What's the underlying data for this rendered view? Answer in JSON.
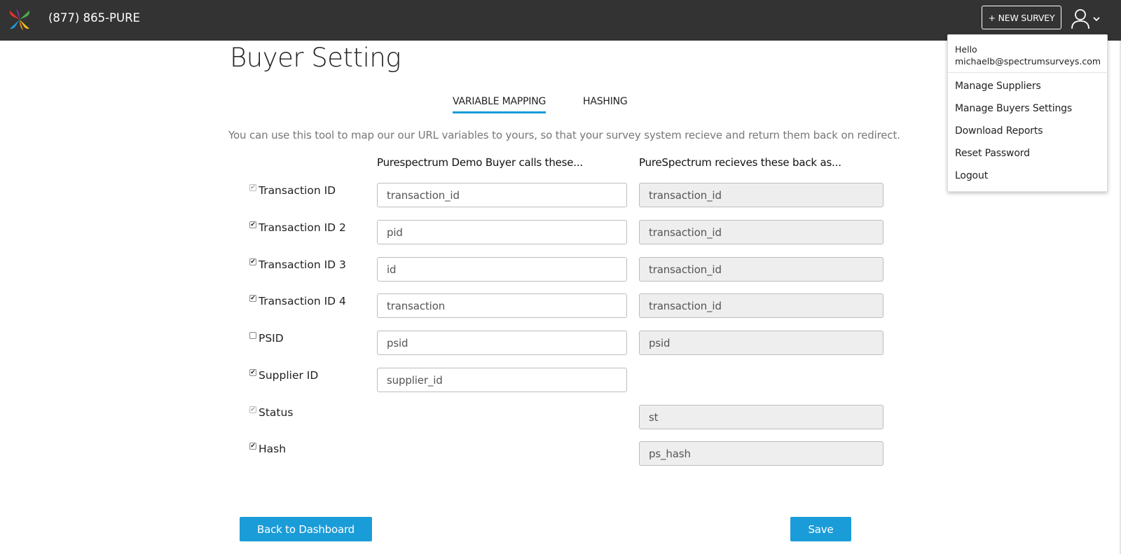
{
  "header": {
    "phone": "(877) 865-PURE",
    "new_survey_label": "+ NEW SURVEY",
    "background_color": "#333333"
  },
  "page": {
    "title": "Buyer Setting",
    "tabs": [
      {
        "label": "VARIABLE MAPPING",
        "active": true
      },
      {
        "label": "HASHING",
        "active": false
      }
    ],
    "intro": "You can use this tool to map our our URL variables to yours, so that your survey system recieve and return them back on redirect.",
    "col_left_header": "Purespectrum Demo Buyer calls these...",
    "col_right_header": "PureSpectrum recieves these back as..."
  },
  "rows": [
    {
      "label": "Transaction ID",
      "checked": true,
      "disabled": true,
      "buyer_value": "transaction_id",
      "ps_value": "transaction_id"
    },
    {
      "label": "Transaction ID 2",
      "checked": true,
      "disabled": false,
      "buyer_value": "pid",
      "ps_value": "transaction_id"
    },
    {
      "label": "Transaction ID 3",
      "checked": true,
      "disabled": false,
      "buyer_value": "id",
      "ps_value": "transaction_id"
    },
    {
      "label": "Transaction ID 4",
      "checked": true,
      "disabled": false,
      "buyer_value": "transaction",
      "ps_value": "transaction_id"
    },
    {
      "label": "PSID",
      "checked": false,
      "disabled": false,
      "buyer_value": "psid",
      "ps_value": "psid"
    },
    {
      "label": "Supplier ID",
      "checked": true,
      "disabled": false,
      "buyer_value": "supplier_id",
      "ps_value": ""
    },
    {
      "label": "Status",
      "checked": true,
      "disabled": true,
      "buyer_value": "",
      "ps_value": "st"
    },
    {
      "label": "Hash",
      "checked": true,
      "disabled": false,
      "buyer_value": "",
      "ps_value": "ps_hash"
    }
  ],
  "actions": {
    "back_label": "Back to Dashboard",
    "save_label": "Save",
    "accent_color": "#1a9cd8"
  },
  "user_menu": {
    "hello": "Hello",
    "email": "michaelb@spectrumsurveys.com",
    "items": [
      "Manage Suppliers",
      "Manage Buyers Settings",
      "Download Reports",
      "Reset Password",
      "Logout"
    ]
  }
}
